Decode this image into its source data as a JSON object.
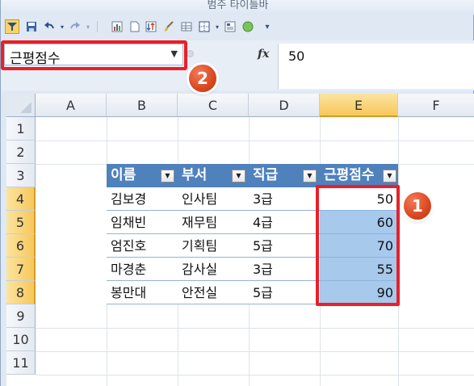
{
  "window": {
    "title": "범주 타이틀바"
  },
  "toolbar": {
    "icons": [
      "filter-icon",
      "save-icon",
      "undo-icon",
      "redo-icon",
      "chart-icon",
      "new-doc-icon",
      "sort-icon",
      "brush-icon",
      "table-icon",
      "border-icon",
      "sheet-icon",
      "circle-icon",
      "customize-icon"
    ]
  },
  "namebox": {
    "value": "근평점수"
  },
  "formula": {
    "fx": "fx",
    "value": "50"
  },
  "columns": [
    "A",
    "B",
    "C",
    "D",
    "E",
    "F"
  ],
  "rows": [
    "1",
    "2",
    "3",
    "4",
    "5",
    "6",
    "7",
    "8",
    "9",
    "10",
    "11"
  ],
  "table": {
    "headers": [
      "이름",
      "부서",
      "직급",
      "근평점수"
    ],
    "rows": [
      [
        "김보경",
        "인사팀",
        "3급",
        "50"
      ],
      [
        "임채빈",
        "재무팀",
        "4급",
        "60"
      ],
      [
        "엄진호",
        "기획팀",
        "5급",
        "70"
      ],
      [
        "마경춘",
        "감사실",
        "3급",
        "55"
      ],
      [
        "봉만대",
        "안전실",
        "5급",
        "90"
      ]
    ]
  },
  "badges": {
    "one": "1",
    "two": "2"
  },
  "colors": {
    "header_blue": "#4f81bd",
    "selection": "#a6c9ec",
    "highlight_red": "#e8202a",
    "badge": "#d9481f"
  }
}
